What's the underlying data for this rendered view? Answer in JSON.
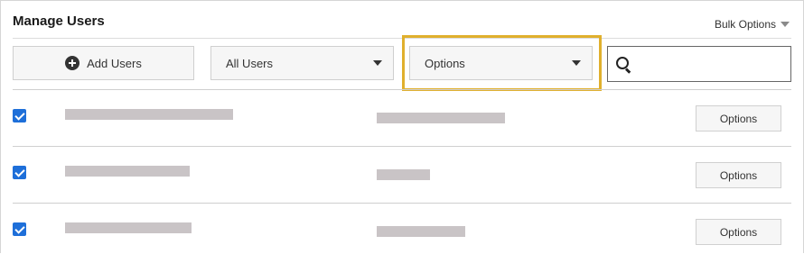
{
  "header": {
    "title": "Manage Users",
    "bulk_options_label": "Bulk Options"
  },
  "toolbar": {
    "add_users_label": "Add Users",
    "filter_select": {
      "selected": "All Users"
    },
    "options_select": {
      "selected": "Options"
    },
    "search": {
      "value": "",
      "placeholder": ""
    }
  },
  "rows": [
    {
      "checked": true,
      "options_label": "Options"
    },
    {
      "checked": true,
      "options_label": "Options"
    },
    {
      "checked": true,
      "options_label": "Options"
    }
  ],
  "colors": {
    "highlight": "#e0b02d",
    "checkbox": "#1e6fd9",
    "placeholder_bar": "#c9c4c6"
  }
}
